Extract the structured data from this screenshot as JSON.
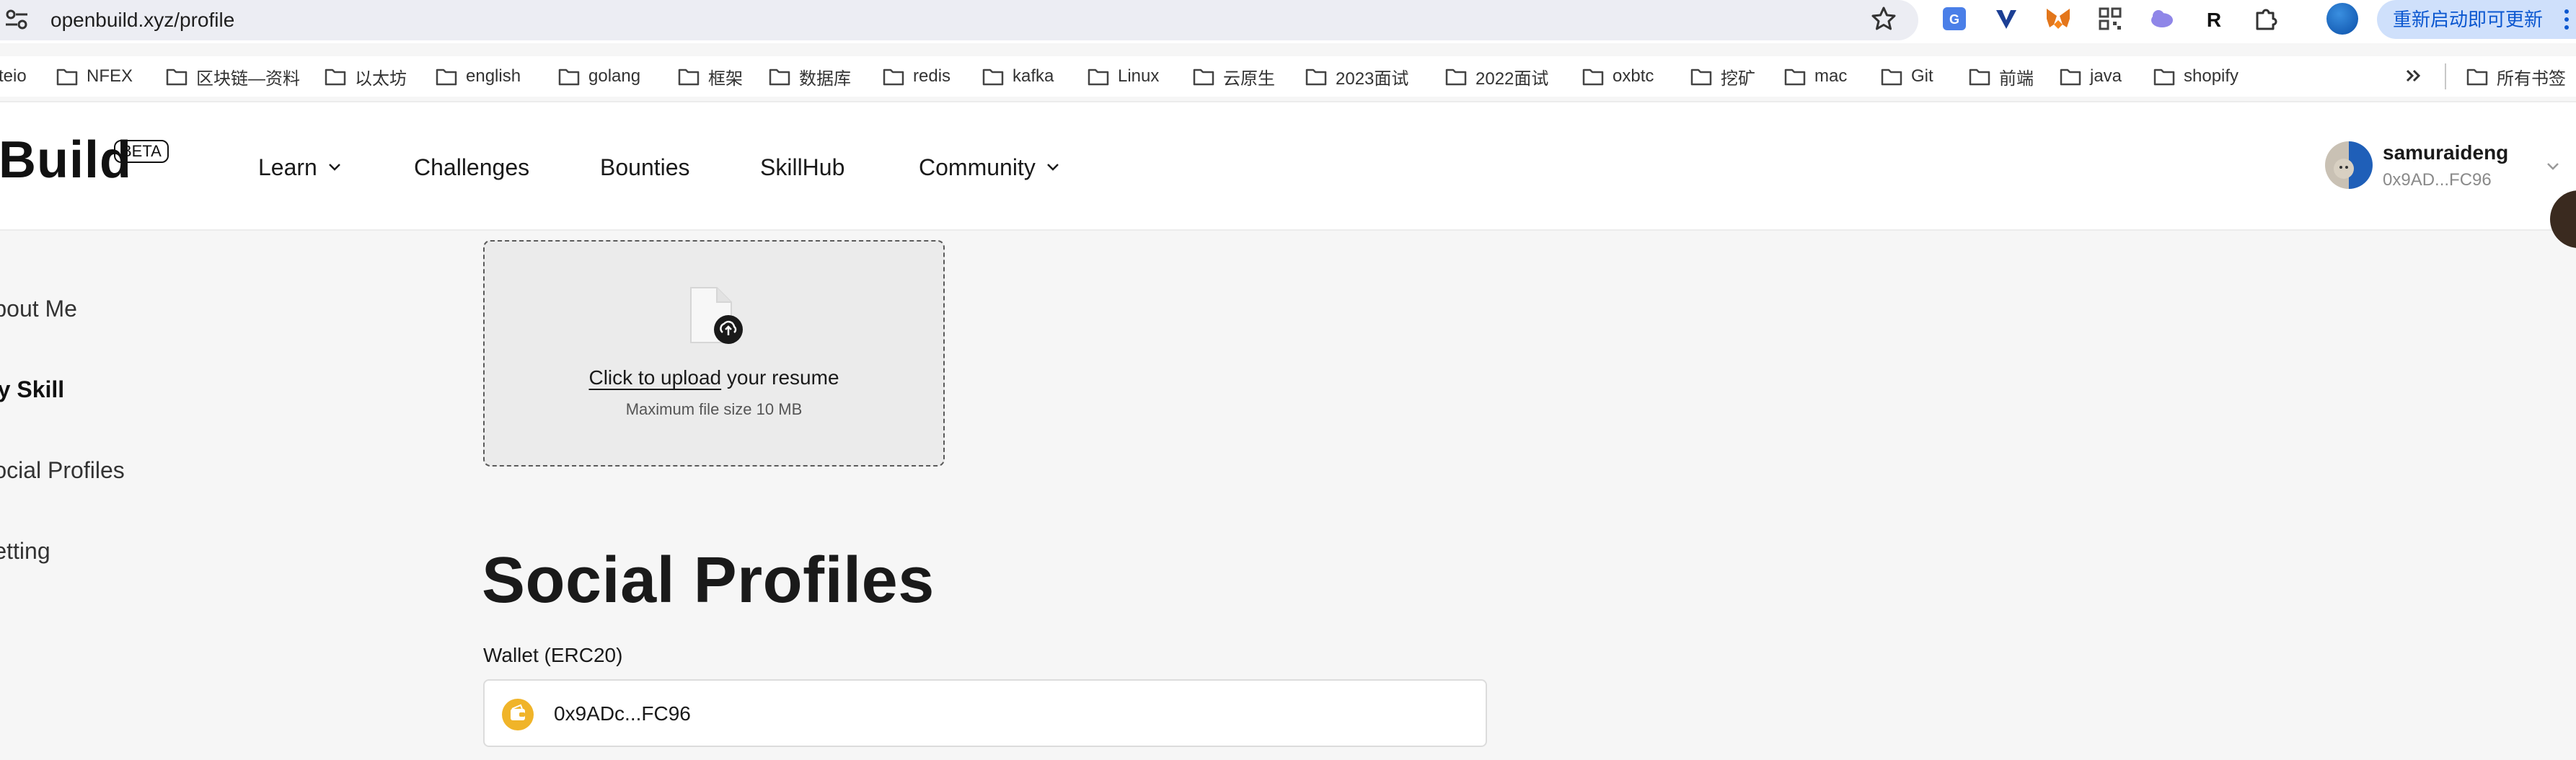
{
  "browser": {
    "url": "openbuild.xyz/profile",
    "update_button": "重新启动即可更新",
    "bookmarks": [
      "teio",
      "NFEX",
      "区块链—资料",
      "以太坊",
      "english",
      "golang",
      "框架",
      "数据库",
      "redis",
      "kafka",
      "Linux",
      "云原生",
      "2023面试",
      "2022面试",
      "oxbtc",
      "挖矿",
      "mac",
      "Git",
      "前端",
      "java",
      "shopify"
    ],
    "all_bookmarks": "所有书签"
  },
  "header": {
    "logo": "Build",
    "beta": "BETA",
    "nav": [
      {
        "label": "Learn",
        "dropdown": true
      },
      {
        "label": "Challenges",
        "dropdown": false
      },
      {
        "label": "Bounties",
        "dropdown": false
      },
      {
        "label": "SkillHub",
        "dropdown": false
      },
      {
        "label": "Community",
        "dropdown": true
      }
    ],
    "user": {
      "name": "samuraideng",
      "address": "0x9AD...FC96"
    }
  },
  "sidebar": {
    "items": [
      {
        "label": "About Me",
        "active": false
      },
      {
        "label": "My Skill",
        "active": true
      },
      {
        "label": "Social Profiles",
        "active": false
      },
      {
        "label": "Setting",
        "active": false
      }
    ]
  },
  "upload": {
    "link_text": "Click to upload",
    "rest_text": " your resume",
    "hint": "Maximum file size 10 MB"
  },
  "social": {
    "title": "Social Profiles",
    "wallet_label": "Wallet (ERC20)",
    "wallet_value": "0x9ADc...FC96"
  },
  "colors": {
    "page_bg": "#f6f6f6",
    "header_bg": "#ffffff",
    "wallet_icon": "#f0b429",
    "update_button_bg": "#cfe0fb",
    "update_button_text": "#0b57d0"
  },
  "icons": {
    "site_info": "tune-icon",
    "bookmark_star": "star-icon",
    "folder": "folder-icon",
    "upload": "file-upload-icon",
    "wallet": "wallet-icon",
    "nav_dropdown": "chevron-down-icon"
  }
}
